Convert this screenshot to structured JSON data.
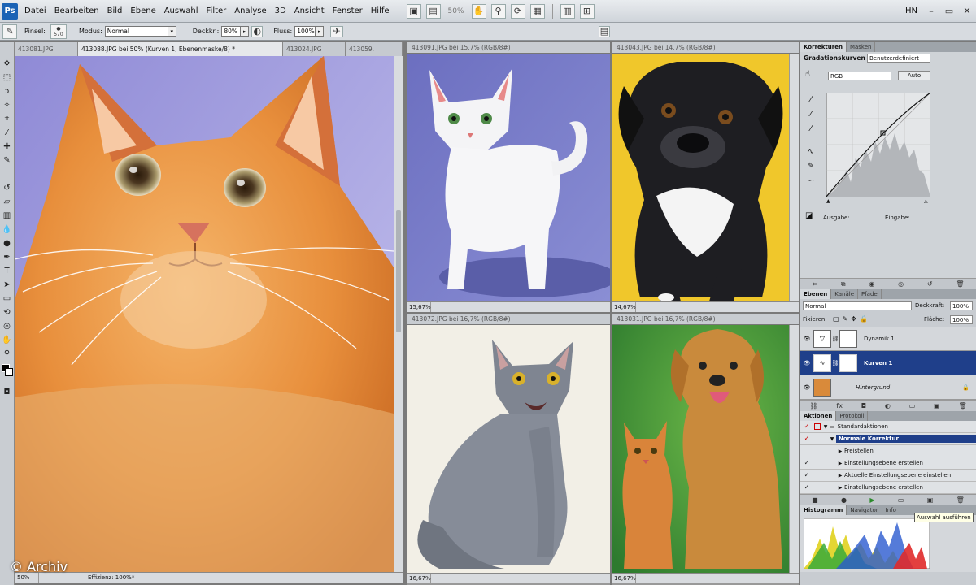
{
  "menubar": {
    "logo": "Ps",
    "items": [
      "Datei",
      "Bearbeiten",
      "Bild",
      "Ebene",
      "Auswahl",
      "Filter",
      "Analyse",
      "3D",
      "Ansicht",
      "Fenster",
      "Hilfe"
    ],
    "zoom": "50%",
    "user": "HN"
  },
  "options": {
    "brush_label": "Pinsel:",
    "brush_size": "570",
    "mode_label": "Modus:",
    "mode_value": "Normal",
    "opacity_label": "Deckkr.:",
    "opacity_value": "80%",
    "flow_label": "Fluss:",
    "flow_value": "100%"
  },
  "tabs": [
    "413081.JPG",
    "413088.JPG bei 50% (Kurven 1, Ebenenmaske/8) *",
    "413024.JPG",
    "413059."
  ],
  "docs": [
    {
      "title": "413091.JPG bei 15,7% (RGB/8#)",
      "zoom": "15,67%"
    },
    {
      "title": "413043.JPG bei 14,7% (RGB/8#)",
      "zoom": "14,67%"
    },
    {
      "title": "413072.JPG bei 16,7% (RGB/8#)",
      "zoom": "16,67%"
    },
    {
      "title": "413031.JPG bei 16,7% (RGB/8#)",
      "zoom": "16,67%"
    }
  ],
  "main_status": {
    "zoom": "50%",
    "info": "Effizienz: 100%*"
  },
  "panels": {
    "corrections": {
      "tabs": [
        "Korrekturen",
        "Masken"
      ],
      "title": "Gradationskurven",
      "preset": "Benutzerdefiniert",
      "channel": "RGB",
      "auto": "Auto",
      "output_label": "Ausgabe:",
      "input_label": "Eingabe:"
    },
    "layers": {
      "tabs": [
        "Ebenen",
        "Kanäle",
        "Pfade"
      ],
      "blend": "Normal",
      "opacity_label": "Deckkraft:",
      "opacity": "100%",
      "lock_label": "Fixieren:",
      "fill_label": "Fläche:",
      "fill": "100%",
      "items": [
        "Dynamik 1",
        "Kurven 1",
        "Hintergrund"
      ]
    },
    "actions": {
      "tabs": [
        "Aktionen",
        "Protokoll"
      ],
      "set": "Standardaktionen",
      "action": "Normale Korrektur",
      "steps": [
        "Freistellen",
        "Einstellungsebene erstellen",
        "Aktuelle Einstellungsebene einstellen",
        "Einstellungsebene erstellen"
      ]
    },
    "histogram": {
      "tabs": [
        "Histogramm",
        "Navigator",
        "Info"
      ]
    }
  },
  "tooltip": "Auswahl ausführen",
  "watermark": "© Archiv"
}
